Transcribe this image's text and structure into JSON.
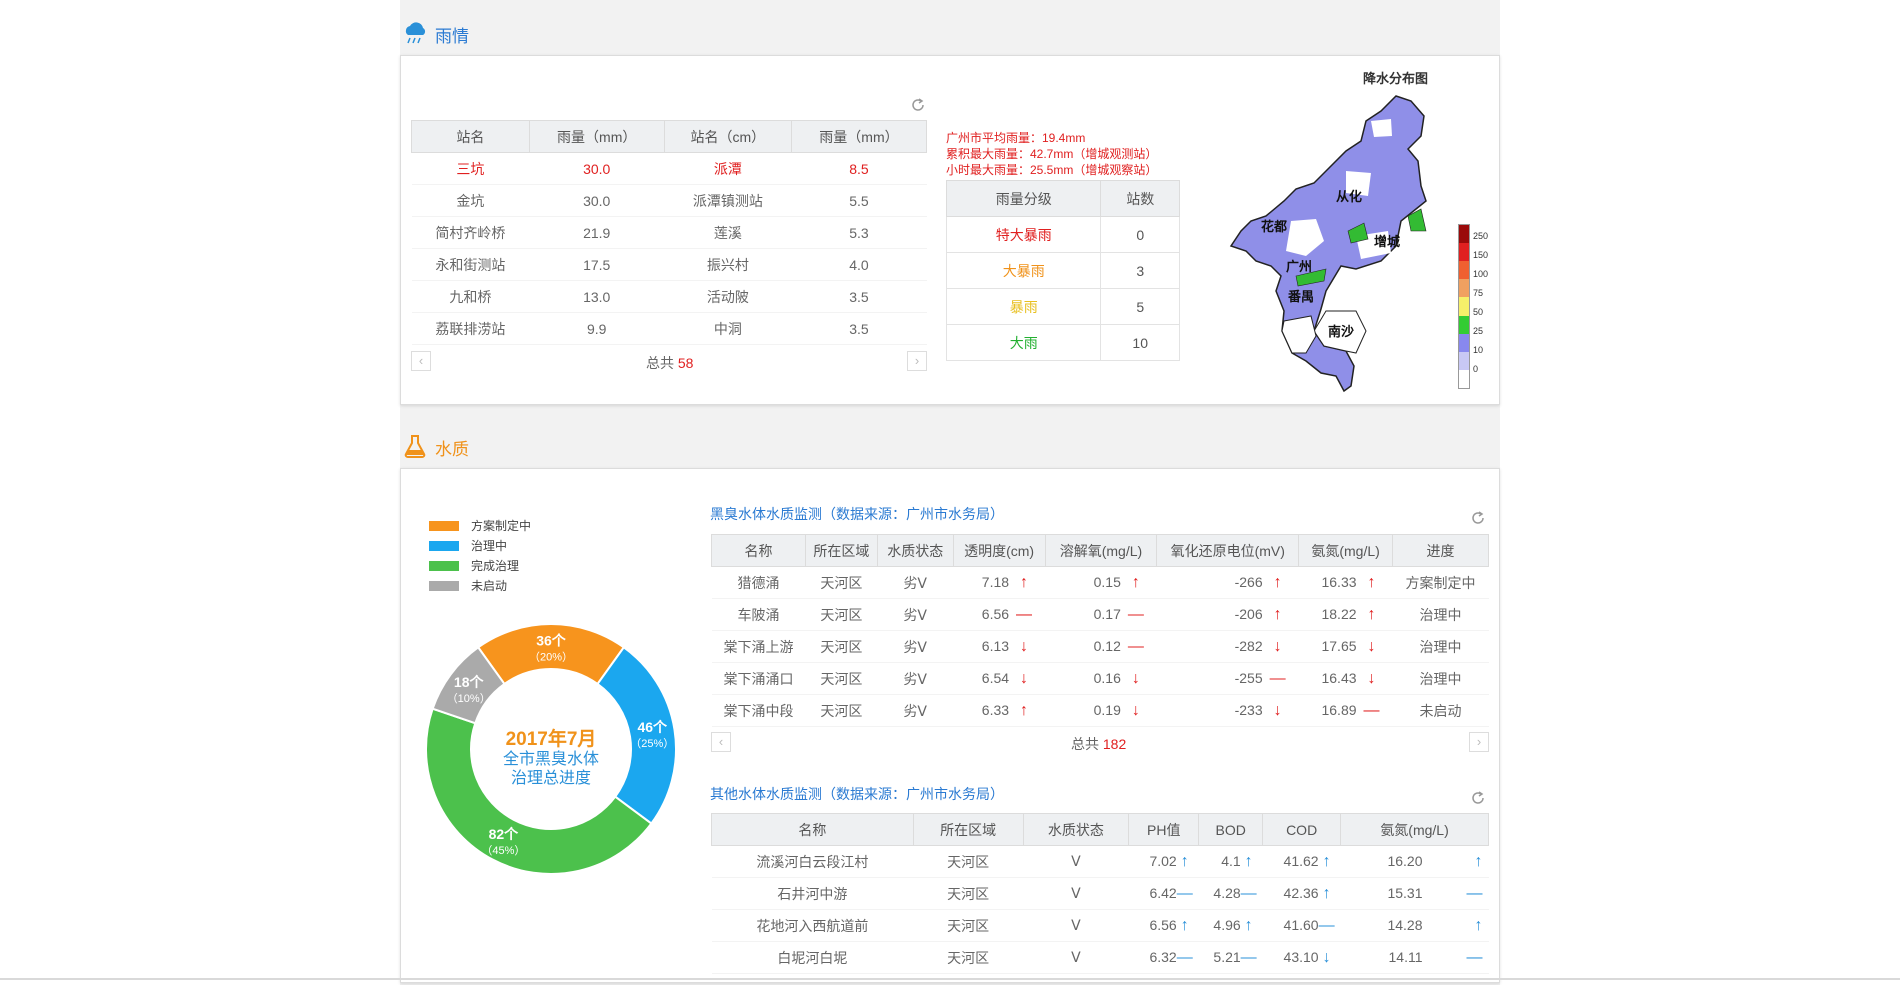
{
  "rain": {
    "section_title": "雨情",
    "table": {
      "headers": [
        "站名",
        "雨量（mm）",
        "站名（cm）",
        "雨量（mm）"
      ],
      "rows": [
        [
          "三坑",
          "30.0",
          "派潭",
          "8.5"
        ],
        [
          "金坑",
          "30.0",
          "派潭镇测站",
          "5.5"
        ],
        [
          "简村齐岭桥",
          "21.9",
          "莲溪",
          "5.3"
        ],
        [
          "永和街测站",
          "17.5",
          "振兴村",
          "4.0"
        ],
        [
          "九和桥",
          "13.0",
          "活动陂",
          "3.5"
        ],
        [
          "荔联排涝站",
          "9.9",
          "中洞",
          "3.5"
        ]
      ]
    },
    "total_label": "总共",
    "total_value": "58",
    "stats": [
      "广州市平均雨量：19.4mm",
      "累积最大雨量：42.7mm（增城观测站）",
      "小时最大雨量：25.5mm（增城观察站）"
    ],
    "grade_table": {
      "headers": [
        "雨量分级",
        "站数"
      ],
      "rows": [
        {
          "grade": "特大暴雨",
          "count": "0",
          "color": "#e02020"
        },
        {
          "grade": "大暴雨",
          "count": "3",
          "color": "#f0921a"
        },
        {
          "grade": "暴雨",
          "count": "5",
          "color": "#e8c020"
        },
        {
          "grade": "大雨",
          "count": "10",
          "color": "#22b030"
        }
      ]
    },
    "map": {
      "title": "降水分布图",
      "districts": [
        "从化",
        "花都",
        "增城",
        "广州",
        "番禺",
        "南沙"
      ],
      "legend_ticks": [
        "250",
        "150",
        "100",
        "75",
        "50",
        "25",
        "10",
        "0"
      ],
      "legend_colors": [
        "#9a0a0a",
        "#e02020",
        "#f06030",
        "#f0a060",
        "#f6f06a",
        "#33cc33",
        "#8888ee",
        "#c8c8f4",
        "#ffffff"
      ]
    }
  },
  "water": {
    "section_title": "水质",
    "legend": [
      {
        "label": "方案制定中",
        "color": "#f7941d"
      },
      {
        "label": "治理中",
        "color": "#1ba7ef"
      },
      {
        "label": "完成治理",
        "color": "#4cc14c"
      },
      {
        "label": "未启动",
        "color": "#aaaaaa"
      }
    ],
    "donut": {
      "center_line1": "2017年7月",
      "center_line2": "全市黑臭水体",
      "center_line3": "治理总进度",
      "slices": [
        {
          "label": "36个",
          "pct": "（20%）",
          "value": 36,
          "color": "#f7941d"
        },
        {
          "label": "46个",
          "pct": "（25%）",
          "value": 46,
          "color": "#1ba7ef"
        },
        {
          "label": "82个",
          "pct": "（45%）",
          "value": 82,
          "color": "#4cc14c"
        },
        {
          "label": "18个",
          "pct": "（10%）",
          "value": 18,
          "color": "#aaaaaa"
        }
      ]
    },
    "black_table": {
      "title": "黑臭水体水质监测（数据来源：广州市水务局）",
      "headers": [
        "名称",
        "所在区域",
        "水质状态",
        "透明度(cm)",
        "溶解氧(mg/L)",
        "氧化还原电位(mV)",
        "氨氮(mg/L)",
        "进度"
      ],
      "rows": [
        {
          "name": "猎德涌",
          "area": "天河区",
          "status": "劣Ⅴ",
          "t": "7.18",
          "ta": "↑",
          "o": "0.15",
          "oa": "↑",
          "r": "-266",
          "ra": "↑",
          "n": "16.33",
          "na": "↑",
          "p": "方案制定中"
        },
        {
          "name": "车陂涌",
          "area": "天河区",
          "status": "劣Ⅴ",
          "t": "6.56",
          "ta": "—",
          "o": "0.17",
          "oa": "—",
          "r": "-206",
          "ra": "↑",
          "n": "18.22",
          "na": "↑",
          "p": "治理中"
        },
        {
          "name": "棠下涌上游",
          "area": "天河区",
          "status": "劣Ⅴ",
          "t": "6.13",
          "ta": "↓",
          "o": "0.12",
          "oa": "—",
          "r": "-282",
          "ra": "↓",
          "n": "17.65",
          "na": "↓",
          "p": "治理中"
        },
        {
          "name": "棠下涌涌口",
          "area": "天河区",
          "status": "劣Ⅴ",
          "t": "6.54",
          "ta": "↓",
          "o": "0.16",
          "oa": "↓",
          "r": "-255",
          "ra": "—",
          "n": "16.43",
          "na": "↓",
          "p": "治理中"
        },
        {
          "name": "棠下涌中段",
          "area": "天河区",
          "status": "劣Ⅴ",
          "t": "6.33",
          "ta": "↑",
          "o": "0.19",
          "oa": "↓",
          "r": "-233",
          "ra": "↓",
          "n": "16.89",
          "na": "—",
          "p": "未启动"
        }
      ],
      "total_label": "总共",
      "total_value": "182"
    },
    "other_table": {
      "title": "其他水体水质监测（数据来源：广州市水务局）",
      "headers": [
        "名称",
        "所在区域",
        "水质状态",
        "PH值",
        "BOD",
        "COD",
        "氨氮(mg/L)"
      ],
      "rows": [
        {
          "name": "流溪河白云段江村",
          "area": "天河区",
          "status": "Ⅴ",
          "ph": "7.02",
          "pha": "↑",
          "bod": "4.1",
          "boda": "↑",
          "cod": "41.62",
          "coda": "↑",
          "n": "16.20",
          "na": "↑"
        },
        {
          "name": "石井河中游",
          "area": "天河区",
          "status": "Ⅴ",
          "ph": "6.42",
          "pha": "—",
          "bod": "4.28",
          "boda": "—",
          "cod": "42.36",
          "coda": "↑",
          "n": "15.31",
          "na": "—"
        },
        {
          "name": "花地河入西航道前",
          "area": "天河区",
          "status": "Ⅴ",
          "ph": "6.56",
          "pha": "↑",
          "bod": "4.96",
          "boda": "↑",
          "cod": "41.60",
          "coda": "—",
          "n": "14.28",
          "na": "↑"
        },
        {
          "name": "白坭河白坭",
          "area": "天河区",
          "status": "Ⅴ",
          "ph": "6.32",
          "pha": "—",
          "bod": "5.21",
          "boda": "—",
          "cod": "43.10",
          "coda": "↓",
          "n": "14.11",
          "na": "—"
        }
      ]
    }
  }
}
